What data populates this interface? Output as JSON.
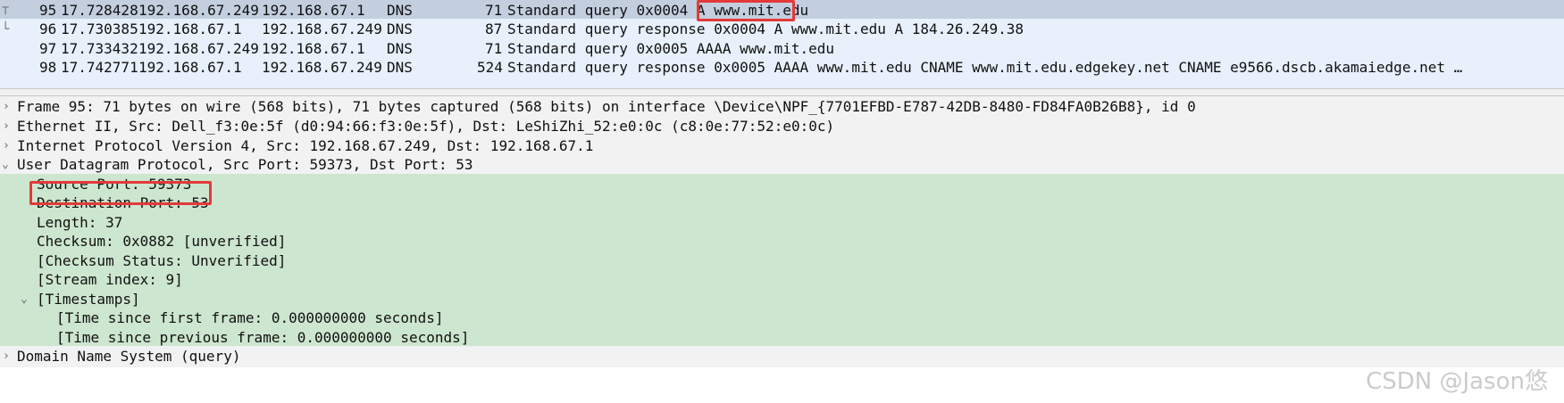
{
  "packets": [
    {
      "no": "95",
      "time": "17.728428",
      "src": "192.168.67.249",
      "dst": "192.168.67.1",
      "proto": "DNS",
      "len": "71",
      "info_prefix": "Standard query 0x0004 A ",
      "info_highlight": "www.mit.edu",
      "selected": true
    },
    {
      "no": "96",
      "time": "17.730385",
      "src": "192.168.67.1",
      "dst": "192.168.67.249",
      "proto": "DNS",
      "len": "87",
      "info_prefix": "Standard query response 0x0004 A www.mit.edu A 184.26.249.38",
      "info_highlight": "",
      "selected": false
    },
    {
      "no": "97",
      "time": "17.733432",
      "src": "192.168.67.249",
      "dst": "192.168.67.1",
      "proto": "DNS",
      "len": "71",
      "info_prefix": "Standard query 0x0005 AAAA www.mit.edu",
      "info_highlight": "",
      "selected": false
    },
    {
      "no": "98",
      "time": "17.742771",
      "src": "192.168.67.1",
      "dst": "192.168.67.249",
      "proto": "DNS",
      "len": "524",
      "info_prefix": "Standard query response 0x0005 AAAA www.mit.edu CNAME www.mit.edu.edgekey.net CNAME e9566.dscb.akamaiedge.net …",
      "info_highlight": "",
      "selected": false
    }
  ],
  "details": [
    {
      "text": "Frame 95: 71 bytes on wire (568 bits), 71 bytes captured (568 bits) on interface \\Device\\NPF_{7701EFBD-E787-42DB-8480-FD84FA0B26B8}, id 0",
      "arrow": "›"
    },
    {
      "text": "Ethernet II, Src: Dell_f3:0e:5f (d0:94:66:f3:0e:5f), Dst: LeShiZhi_52:e0:0c (c8:0e:77:52:e0:0c)",
      "arrow": "›"
    },
    {
      "text": "Internet Protocol Version 4, Src: 192.168.67.249, Dst: 192.168.67.1",
      "arrow": "›"
    },
    {
      "text": "User Datagram Protocol, Src Port: 59373, Dst Port: 53",
      "arrow": "⌄"
    },
    {
      "text": "Source Port: 59373",
      "arrow": ""
    },
    {
      "text": "Destination Port: 53",
      "arrow": ""
    },
    {
      "text": "Length: 37",
      "arrow": ""
    },
    {
      "text": "Checksum: 0x0882 [unverified]",
      "arrow": ""
    },
    {
      "text": "[Checksum Status: Unverified]",
      "arrow": ""
    },
    {
      "text": "[Stream index: 9]",
      "arrow": ""
    },
    {
      "text": "[Timestamps]",
      "arrow": "⌄"
    },
    {
      "text": "[Time since first frame: 0.000000000 seconds]",
      "arrow": ""
    },
    {
      "text": "[Time since previous frame: 0.000000000 seconds]",
      "arrow": ""
    },
    {
      "text": "Domain Name System (query)",
      "arrow": "›"
    }
  ],
  "watermark": "CSDN @Jason悠",
  "colors": {
    "selected_row": "#c3cfdf",
    "packet_row": "#e7f0fb",
    "udp_tree": "#cde6cf",
    "highlight_box": "#e23a3a"
  }
}
